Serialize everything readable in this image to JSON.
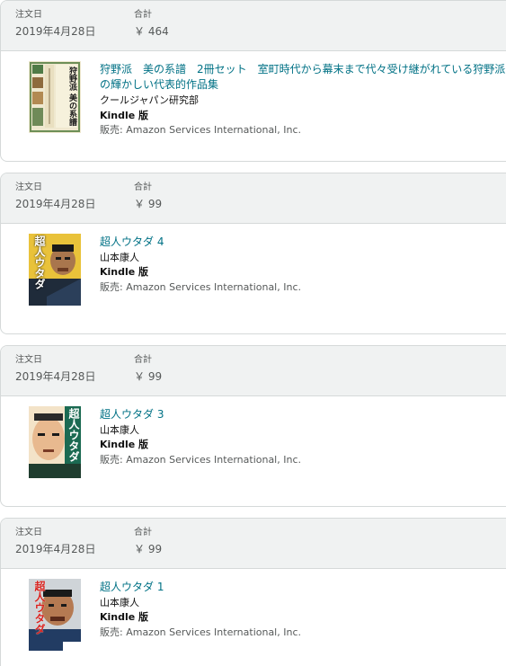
{
  "orders": [
    {
      "order_date_label": "注文日",
      "order_date": "2019年4月28日",
      "total_label": "合計",
      "total": "￥ 464",
      "item": {
        "title": "狩野派　美の系譜　2冊セット　室町時代から幕末まで代々受け継がれている狩野派の輝かしい代表的作品集",
        "author": "クールジャパン研究部",
        "format": "Kindle 版",
        "seller": "販売: Amazon Services International, Inc.",
        "cover_text": "狩野派 美の系譜"
      }
    },
    {
      "order_date_label": "注文日",
      "order_date": "2019年4月28日",
      "total_label": "合計",
      "total": "￥ 99",
      "item": {
        "title": "超人ウタダ 4",
        "author": "山本康人",
        "format": "Kindle 版",
        "seller": "販売: Amazon Services International, Inc.",
        "cover_text": "超人ウタダ"
      }
    },
    {
      "order_date_label": "注文日",
      "order_date": "2019年4月28日",
      "total_label": "合計",
      "total": "￥ 99",
      "item": {
        "title": "超人ウタダ 3",
        "author": "山本康人",
        "format": "Kindle 版",
        "seller": "販売: Amazon Services International, Inc.",
        "cover_text": "超人ウタダ"
      }
    },
    {
      "order_date_label": "注文日",
      "order_date": "2019年4月28日",
      "total_label": "合計",
      "total": "￥ 99",
      "item": {
        "title": "超人ウタダ 1",
        "author": "山本康人",
        "format": "Kindle 版",
        "seller": "販売: Amazon Services International, Inc.",
        "cover_text": "超人ウタダ"
      }
    }
  ],
  "colors": {
    "link": "#007185",
    "header_bg": "#f0f2f2",
    "border": "#d5d9d9"
  }
}
